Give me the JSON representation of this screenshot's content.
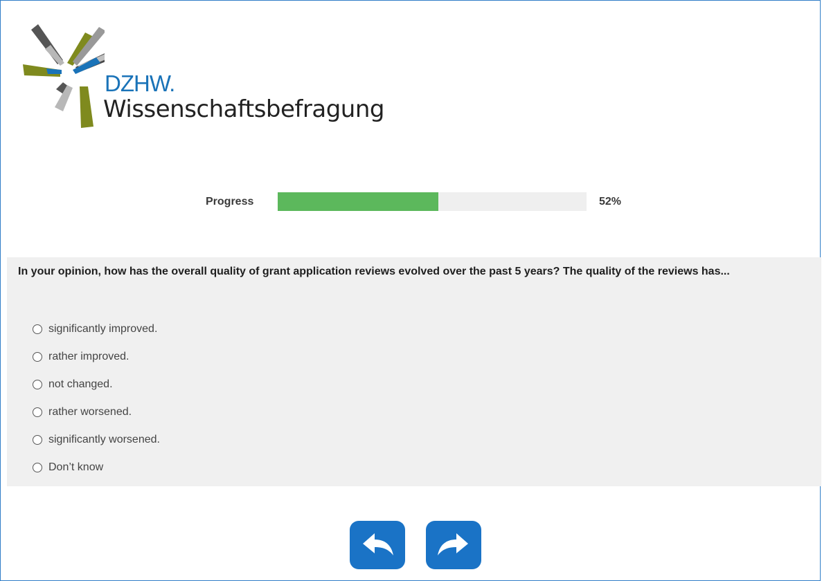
{
  "logo": {
    "brand": "DZHW.",
    "subtitle": "Wissenschaftsbefragung"
  },
  "progress": {
    "label": "Progress",
    "value_text": "52%",
    "fraction": 0.52,
    "fill_color": "#5cb85c"
  },
  "question": {
    "text": "In your opinion, how has the overall quality of grant application reviews evolved over the past 5 years? The quality of the reviews has...",
    "options": [
      "significantly improved.",
      "rather improved.",
      "not changed.",
      "rather worsened.",
      "significantly worsened.",
      "Don’t know"
    ]
  },
  "navigation": {
    "back_icon": "back-arrow-icon",
    "next_icon": "forward-arrow-icon",
    "color": "#1a73c6"
  }
}
